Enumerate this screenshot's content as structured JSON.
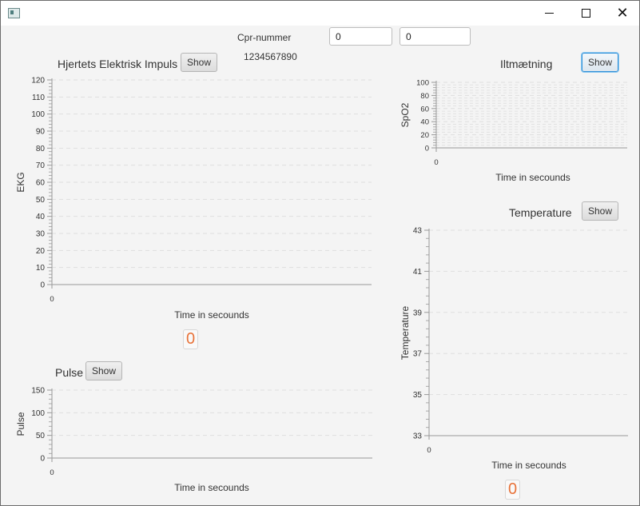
{
  "window": {
    "title": ""
  },
  "header": {
    "cpr_label": "Cpr-nummer",
    "cpr_value": "1234567890",
    "input1_value": "0",
    "input2_value": "0"
  },
  "panels": {
    "ekg": {
      "title": "Hjertets Elektrisk Impuls",
      "button": "Show",
      "counter": "0"
    },
    "pulse": {
      "title": "Pulse",
      "button": "Show"
    },
    "spo2": {
      "title": "Iltmætning",
      "button": "Show"
    },
    "temperature": {
      "title": "Temperature",
      "button": "Show",
      "counter": "0"
    }
  },
  "colors": {
    "accent": "#2d8fd8",
    "counter_text": "#e8733a",
    "grid": "#dedede"
  },
  "chart_data": [
    {
      "id": "ekg",
      "type": "line",
      "title": "",
      "xlabel": "Time in secounds",
      "ylabel": "EKG",
      "ylim": [
        0,
        120
      ],
      "y_ticks": [
        0,
        10,
        20,
        30,
        40,
        50,
        60,
        70,
        80,
        90,
        100,
        110,
        120
      ],
      "x_ticks": [
        0
      ],
      "series": [],
      "grid": true
    },
    {
      "id": "pulse",
      "type": "line",
      "title": "",
      "xlabel": "Time in secounds",
      "ylabel": "Pulse",
      "ylim": [
        0,
        150
      ],
      "y_ticks": [
        0,
        50,
        100,
        150
      ],
      "x_ticks": [
        0
      ],
      "series": [],
      "grid": true
    },
    {
      "id": "spo2",
      "type": "line",
      "title": "",
      "xlabel": "Time in secounds",
      "ylabel": "SpO2",
      "ylim": [
        0,
        100
      ],
      "y_ticks": [
        0,
        20,
        40,
        60,
        80,
        100
      ],
      "x_ticks": [
        0
      ],
      "series": [],
      "grid": true
    },
    {
      "id": "temperature",
      "type": "line",
      "title": "",
      "xlabel": "Time in secounds",
      "ylabel": "Temperature",
      "ylim": [
        33,
        43
      ],
      "y_ticks": [
        33,
        35,
        37,
        39,
        41,
        43
      ],
      "x_ticks": [
        0
      ],
      "series": [],
      "grid": true
    }
  ]
}
